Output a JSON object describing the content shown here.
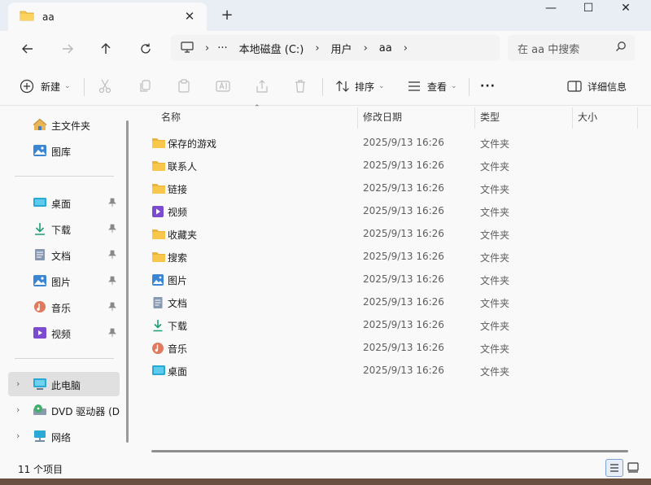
{
  "tab": {
    "title": "aa",
    "close_label": "✕",
    "new_tab_label": "+"
  },
  "window_controls": {
    "minimize": "—",
    "maximize": "☐",
    "close": "✕"
  },
  "address": {
    "more": "···",
    "crumbs": [
      "本地磁盘 (C:)",
      "用户",
      "aa"
    ],
    "separator": "›"
  },
  "search": {
    "placeholder": "在 aa 中搜索"
  },
  "commands": {
    "new_label": "新建",
    "sort_label": "排序",
    "view_label": "查看",
    "more_label": "···",
    "details_label": "详细信息"
  },
  "sidebar": {
    "top_items": [
      {
        "label": "主文件夹",
        "icon": "home-icon"
      },
      {
        "label": "图库",
        "icon": "gallery-icon"
      }
    ],
    "pinned_items": [
      {
        "label": "桌面",
        "icon": "desktop-icon"
      },
      {
        "label": "下载",
        "icon": "download-icon"
      },
      {
        "label": "文档",
        "icon": "document-icon"
      },
      {
        "label": "图片",
        "icon": "pictures-icon"
      },
      {
        "label": "音乐",
        "icon": "music-icon"
      },
      {
        "label": "视频",
        "icon": "video-icon"
      }
    ],
    "drives": [
      {
        "label": "此电脑",
        "icon": "pc-icon",
        "selected": true
      },
      {
        "label": "DVD 驱动器 (D",
        "icon": "dvd-icon",
        "selected": false
      },
      {
        "label": "网络",
        "icon": "network-icon",
        "selected": false
      }
    ]
  },
  "columns": {
    "name": "名称",
    "date": "修改日期",
    "type": "类型",
    "size": "大小"
  },
  "files": [
    {
      "name": "保存的游戏",
      "date": "2025/9/13 16:26",
      "type": "文件夹",
      "icon": "folder-icon"
    },
    {
      "name": "联系人",
      "date": "2025/9/13 16:26",
      "type": "文件夹",
      "icon": "folder-icon"
    },
    {
      "name": "链接",
      "date": "2025/9/13 16:26",
      "type": "文件夹",
      "icon": "folder-icon"
    },
    {
      "name": "视频",
      "date": "2025/9/13 16:26",
      "type": "文件夹",
      "icon": "video-icon"
    },
    {
      "name": "收藏夹",
      "date": "2025/9/13 16:26",
      "type": "文件夹",
      "icon": "folder-icon"
    },
    {
      "name": "搜索",
      "date": "2025/9/13 16:26",
      "type": "文件夹",
      "icon": "folder-icon"
    },
    {
      "name": "图片",
      "date": "2025/9/13 16:26",
      "type": "文件夹",
      "icon": "pictures-icon"
    },
    {
      "name": "文档",
      "date": "2025/9/13 16:26",
      "type": "文件夹",
      "icon": "document-icon"
    },
    {
      "name": "下载",
      "date": "2025/9/13 16:26",
      "type": "文件夹",
      "icon": "download-icon"
    },
    {
      "name": "音乐",
      "date": "2025/9/13 16:26",
      "type": "文件夹",
      "icon": "music-icon"
    },
    {
      "name": "桌面",
      "date": "2025/9/13 16:26",
      "type": "文件夹",
      "icon": "desktop-icon"
    }
  ],
  "status": {
    "item_count": "11 个项目"
  },
  "colors": {
    "accent": "#0067c0",
    "folder": "#f8c64a",
    "selection": "#e0e0e0"
  }
}
